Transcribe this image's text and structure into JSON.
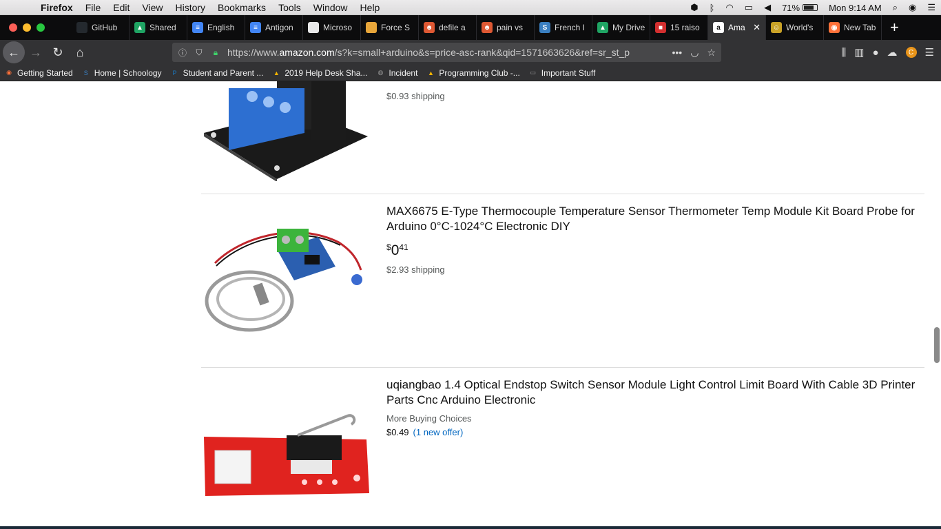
{
  "menubar": {
    "app": "Firefox",
    "items": [
      "File",
      "Edit",
      "View",
      "History",
      "Bookmarks",
      "Tools",
      "Window",
      "Help"
    ],
    "battery": "71%",
    "clock": "Mon 9:14 AM"
  },
  "tabs": [
    {
      "label": "GitHub",
      "color": "#24292e",
      "glyph": ""
    },
    {
      "label": "Shared",
      "color": "#1fa463",
      "glyph": "▲"
    },
    {
      "label": "English",
      "color": "#4285f4",
      "glyph": "≡"
    },
    {
      "label": "Antigon",
      "color": "#4285f4",
      "glyph": "≡"
    },
    {
      "label": "Microso",
      "color": "#e8e8e8",
      "glyph": ""
    },
    {
      "label": "Force S",
      "color": "#e8a63a",
      "glyph": ""
    },
    {
      "label": "defile a",
      "color": "#de5833",
      "glyph": "☻"
    },
    {
      "label": "pain vs",
      "color": "#de5833",
      "glyph": "☻"
    },
    {
      "label": "French I",
      "color": "#3a7fc1",
      "glyph": "S"
    },
    {
      "label": "My Drive",
      "color": "#1fa463",
      "glyph": "▲"
    },
    {
      "label": "15 raiso",
      "color": "#d32f2f",
      "glyph": "■"
    },
    {
      "label": "Ama",
      "color": "#ffffff",
      "glyph": "a",
      "active": true
    },
    {
      "label": "World's",
      "color": "#c9a227",
      "glyph": "☺"
    },
    {
      "label": "New Tab",
      "color": "#ff7139",
      "glyph": "◉"
    }
  ],
  "navbar": {
    "url_prefix": "https://www.",
    "url_domain": "amazon.com",
    "url_rest": "/s?k=small+arduino&s=price-asc-rank&qid=1571663626&ref=sr_st_p",
    "avatar_letter": "C"
  },
  "bookmarks": [
    {
      "label": "Getting Started",
      "icon": "firefox-icon",
      "color": "#ff7139",
      "glyph": "◉"
    },
    {
      "label": "Home | Schoology",
      "icon": "schoology-icon",
      "color": "#3a7fc1",
      "glyph": "S"
    },
    {
      "label": "Student and Parent ...",
      "icon": "powerschool-icon",
      "color": "#1b75bb",
      "glyph": "P"
    },
    {
      "label": "2019 Help Desk Sha...",
      "icon": "drive-icon",
      "color": "#f4b400",
      "glyph": "▲"
    },
    {
      "label": "Incident",
      "icon": "globe-icon",
      "color": "#9a9a9a",
      "glyph": "◍"
    },
    {
      "label": "Programming Club -...",
      "icon": "drive-icon",
      "color": "#f4b400",
      "glyph": "▲"
    },
    {
      "label": "Important Stuff",
      "icon": "folder-icon",
      "color": "#9a9a9a",
      "glyph": "▭"
    }
  ],
  "products": [
    {
      "shipping": "$0.93 shipping"
    },
    {
      "title": "MAX6675 E-Type Thermocouple Temperature Sensor Thermometer Temp Module Kit Board Probe for Arduino 0°C-1024°C Electronic DIY",
      "price_symbol": "$",
      "price_whole": "0",
      "price_fraction": "41",
      "shipping": "$2.93 shipping"
    },
    {
      "title": "uqiangbao 1.4 Optical Endstop Switch Sensor Module Light Control Limit Board With Cable 3D Printer Parts Cnc Arduino Electronic",
      "more_buying": "More Buying Choices",
      "offer_price": "$0.49",
      "offer_link": "(1 new offer)"
    }
  ]
}
